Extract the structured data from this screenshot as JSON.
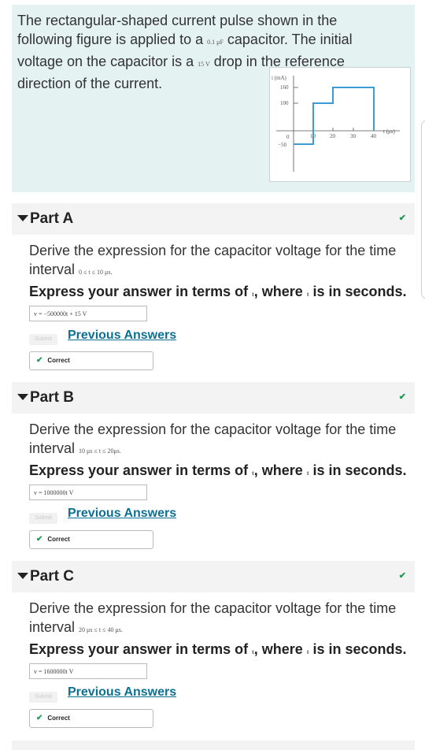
{
  "problem": {
    "text_1": "The rectangular-shaped current pulse shown in the following figure is applied to a ",
    "capacitance": "0.1 μF",
    "text_2": " capacitor. The initial voltage on the capacitor is a ",
    "initial_voltage": "15 V",
    "text_3": " drop in the reference direction of the current."
  },
  "figure": {
    "y_axis_label": "i (mA)",
    "x_axis_label": "t (μs)",
    "y_ticks": [
      "160",
      "100",
      "0",
      "−50"
    ],
    "x_ticks": [
      "10",
      "20",
      "30",
      "40"
    ]
  },
  "parts": [
    {
      "title": "Part A",
      "question": "Derive the expression for the capacitor voltage for the time interval ",
      "interval": "0 ≤ t ≤ 10 μs.",
      "express_1": "Express your answer in terms of ",
      "var_t": "t",
      "express_2": ", where ",
      "express_3": " is in seconds.",
      "answer": "v =  −500000t + 15   V",
      "submit_label": "Submit",
      "prev_label": "Previous Answers",
      "status": "Correct"
    },
    {
      "title": "Part B",
      "question": "Derive the expression for the capacitor voltage for the time interval ",
      "interval": "10 μs ≤ t ≤ 20μs.",
      "express_1": "Express your answer in terms of ",
      "var_t": "t",
      "express_2": ", where ",
      "express_3": " is in seconds.",
      "answer": "v =  1000000t   V",
      "submit_label": "Submit",
      "prev_label": "Previous Answers",
      "status": "Correct"
    },
    {
      "title": "Part C",
      "question": "Derive the expression for the capacitor voltage for the time interval ",
      "interval": "20 μs ≤ t ≤ 40 μs.",
      "express_1": "Express your answer in terms of ",
      "var_t": "t",
      "express_2": ", where ",
      "express_3": " is in seconds.",
      "answer": "v =  1600000t   V",
      "submit_label": "Submit",
      "prev_label": "Previous Answers",
      "status": "Correct"
    }
  ],
  "colors": {
    "link": "#0d6f91",
    "correct": "#1a9b57",
    "problem_bg": "#e4f2f1",
    "graph": "#3a9bd5"
  }
}
